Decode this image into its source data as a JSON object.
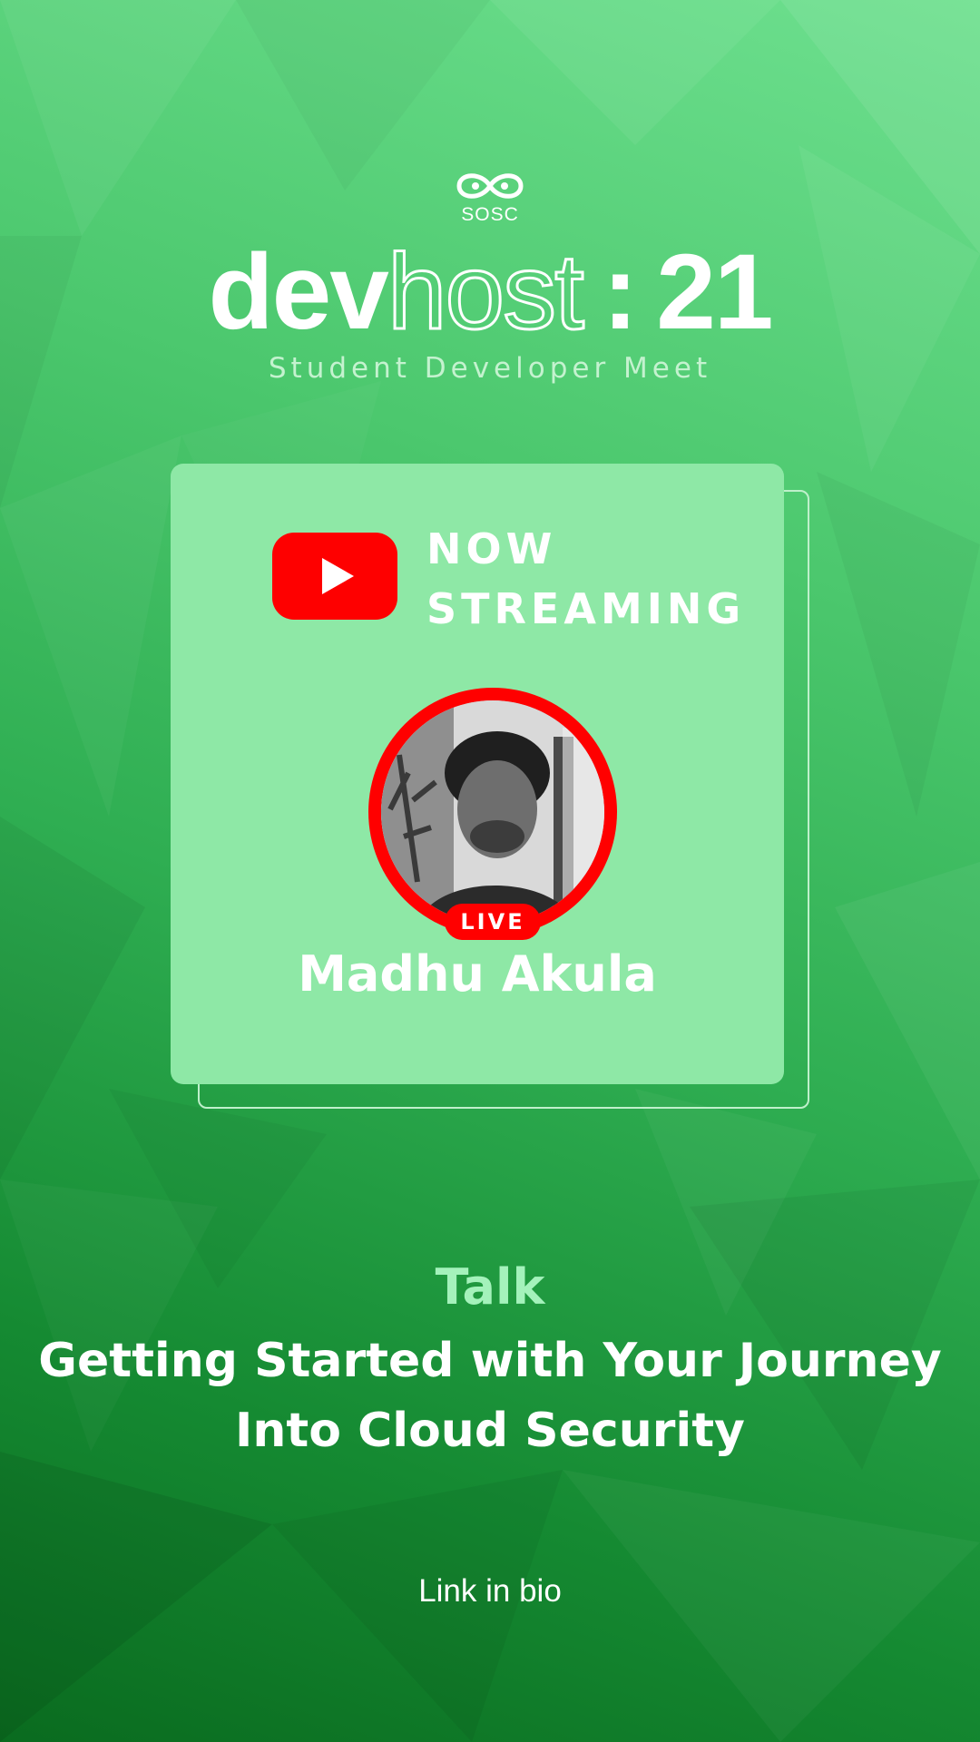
{
  "brand": {
    "org": "SOSC",
    "event_part1": "dev",
    "event_part2": "host",
    "separator": ":",
    "event_year": "21",
    "tagline": "Student Developer Meet"
  },
  "stream": {
    "platform_icon": "youtube-play-icon",
    "status_line1": "NOW",
    "status_line2": "STREAMING",
    "live_badge": "LIVE"
  },
  "speaker": {
    "name": "Madhu Akula"
  },
  "talk": {
    "label": "Talk",
    "title_line1": "Getting Started with Your Journey",
    "title_line2": "Into Cloud Security"
  },
  "footer": {
    "cta": "Link in bio"
  },
  "colors": {
    "background_light": "#6ee08f",
    "background_dark": "#0a6b1f",
    "card": "#8ee8a6",
    "accent_red": "#ff0000",
    "talk_label": "#a4f2bb"
  }
}
